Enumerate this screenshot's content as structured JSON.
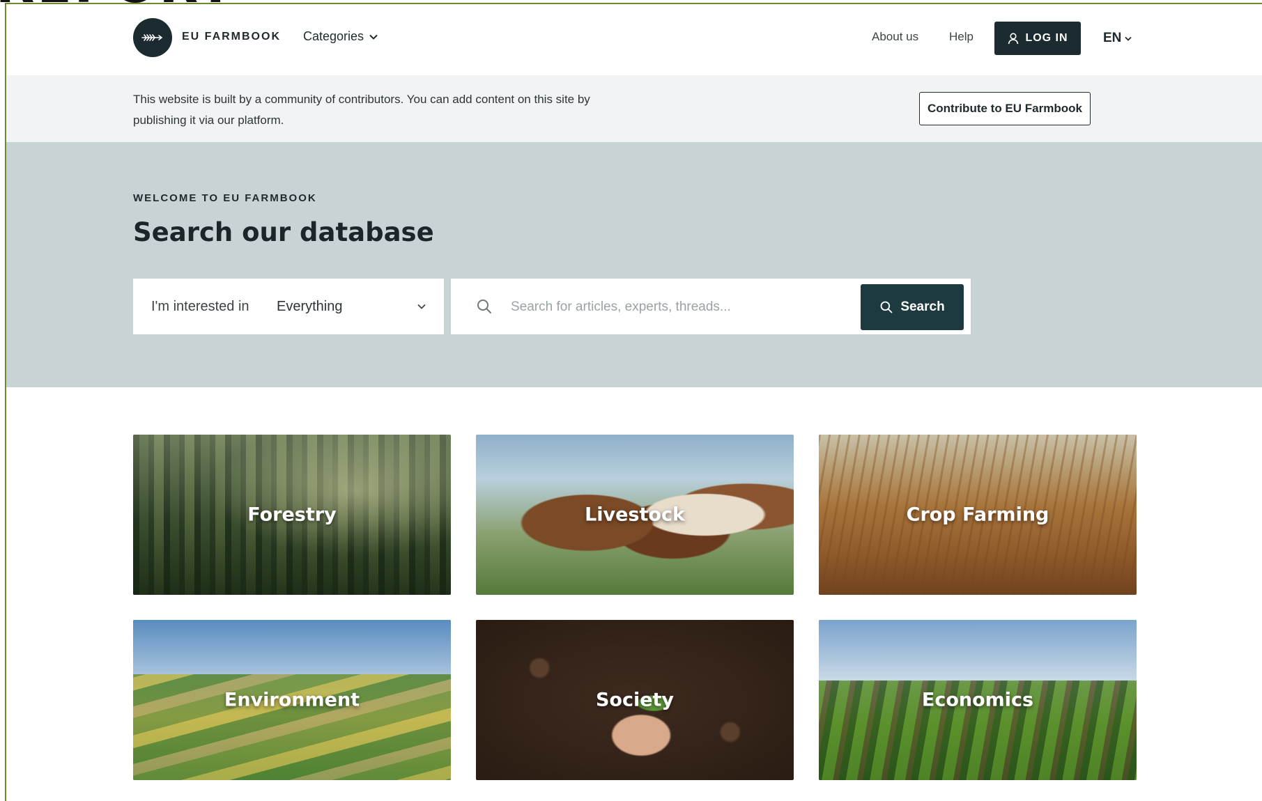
{
  "doc_heading": "REPORT",
  "header": {
    "brand": "EU FARMBOOK",
    "categories_label": "Categories",
    "about_label": "About us",
    "help_label": "Help",
    "login_label": "LOG IN",
    "language": "EN"
  },
  "infobar": {
    "text": "This website is built by a community of contributors. You can add content on this site by publishing it via our platform.",
    "contribute_label": "Contribute to EU Farmbook"
  },
  "hero": {
    "eyebrow": "WELCOME TO EU FARMBOOK",
    "title": "Search our database",
    "select_label": "I'm interested in",
    "select_value": "Everything",
    "search_placeholder": "Search for articles, experts, threads...",
    "search_value": "",
    "search_button": "Search"
  },
  "tiles": [
    {
      "label": "Forestry"
    },
    {
      "label": "Livestock"
    },
    {
      "label": "Crop Farming"
    },
    {
      "label": "Environment"
    },
    {
      "label": "Society"
    },
    {
      "label": "Economics"
    }
  ],
  "colors": {
    "primary_dark": "#1c2b30",
    "search_button": "#1c3a3f",
    "hero_background": "#c8d3d5",
    "infobar_background": "#f2f3f4",
    "frame_border": "#6d8a2e"
  },
  "icons": {
    "logo": "wheat-logo-icon",
    "categories_chevron": "chevron-down-icon",
    "login": "user-icon",
    "language_chevron": "chevron-down-icon",
    "search": "search-icon"
  }
}
